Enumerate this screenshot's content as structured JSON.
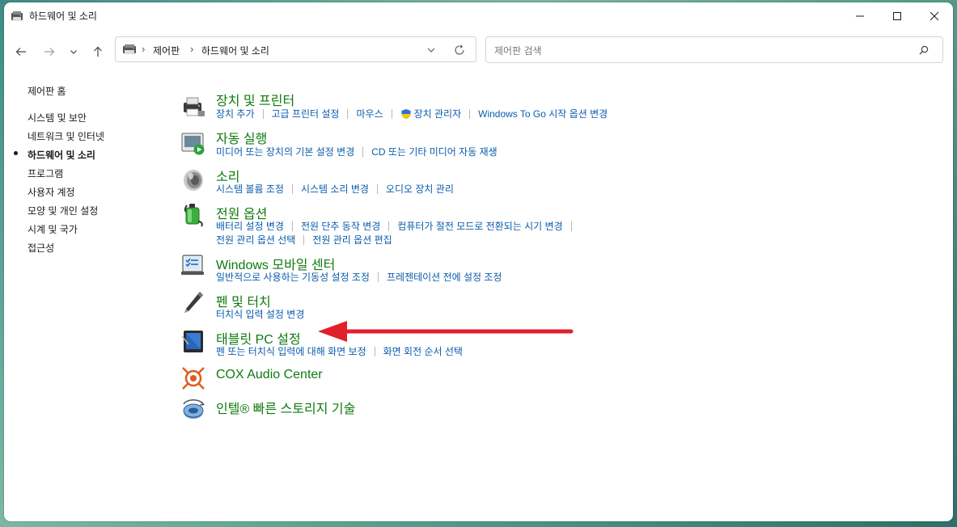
{
  "window": {
    "title": "하드웨어 및 소리"
  },
  "address": {
    "crumbs": [
      "제어판",
      "하드웨어 및 소리"
    ]
  },
  "search": {
    "placeholder": "제어판 검색"
  },
  "sidebar": {
    "items": [
      {
        "label": "제어판 홈"
      },
      {
        "label": "시스템 및 보안"
      },
      {
        "label": "네트워크 및 인터넷"
      },
      {
        "label": "하드웨어 및 소리",
        "active": true
      },
      {
        "label": "프로그램"
      },
      {
        "label": "사용자 계정"
      },
      {
        "label": "모양 및 개인 설정"
      },
      {
        "label": "시계 및 국가"
      },
      {
        "label": "접근성"
      }
    ]
  },
  "categories": [
    {
      "title": "장치 및 프린터",
      "icon": "printer-icon",
      "links": [
        "장치 추가",
        "고급 프린터 설정",
        "마우스",
        "장치 관리자",
        "Windows To Go 시작 옵션 변경"
      ]
    },
    {
      "title": "자동 실행",
      "icon": "autoplay-icon",
      "links": [
        "미디어 또는 장치의 기본 설정 변경",
        "CD 또는 기타 미디어 자동 재생"
      ]
    },
    {
      "title": "소리",
      "icon": "speaker-icon",
      "links": [
        "시스템 볼륨 조정",
        "시스템 소리 변경",
        "오디오 장치 관리"
      ]
    },
    {
      "title": "전원 옵션",
      "icon": "battery-icon",
      "links": [
        "배터리 설정 변경",
        "전원 단추 동작 변경",
        "컴퓨터가 절전 모드로 전환되는 시기 변경"
      ],
      "links2": [
        "전원 관리 옵션 선택",
        "전원 관리 옵션 편집"
      ]
    },
    {
      "title": "Windows 모바일 센터",
      "icon": "mobility-center-icon",
      "links": [
        "일반적으로 사용하는 기동성 설정 조정",
        "프레젠테이션 전에 설정 조정"
      ]
    },
    {
      "title": "펜 및 터치",
      "icon": "pen-icon",
      "links": [
        "터치식 입력 설정 변경"
      ]
    },
    {
      "title": "태블릿 PC 설정",
      "icon": "tablet-icon",
      "links": [
        "펜 또는 터치식 입력에 대해 화면 보정",
        "화면 회전 순서 선택"
      ]
    },
    {
      "title": "COX Audio Center",
      "icon": "cox-audio-icon",
      "links": []
    },
    {
      "title": "인텔® 빠른 스토리지 기술",
      "icon": "intel-storage-icon",
      "links": []
    }
  ],
  "colors": {
    "category_title": "#0e7a0e",
    "link": "#0b5cad",
    "arrow": "#e0202a"
  }
}
